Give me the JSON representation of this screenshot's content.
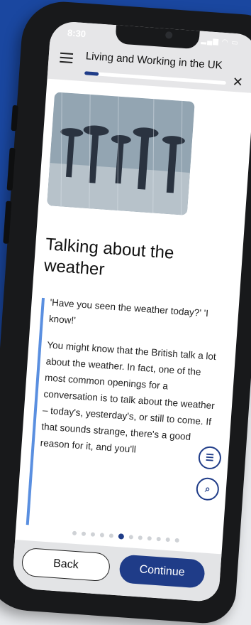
{
  "status_bar": {
    "time": "8:30",
    "icons": "signal wifi battery"
  },
  "header": {
    "title": "Living and Working in the UK",
    "progress": 0.1
  },
  "hero_image": {
    "subject": "people with umbrellas in rain"
  },
  "lesson": {
    "heading": "Talking about the weather",
    "quote": "'Have you seen the weather today?' 'I know!'",
    "paragraph": "You might know that the British talk a lot about the weather. In fact, one of the most common openings for a conversation is to talk about the weather – today's, yesterday's, or still to come. If that sounds strange, there's a good reason for it, and you'll"
  },
  "pagination": {
    "current": 6,
    "total": 14
  },
  "buttons": {
    "back": "Back",
    "continue": "Continue"
  },
  "colors": {
    "brand": "#1f3c88",
    "accent_bar": "#5a8fe0",
    "blue_bg": "#1a47a0"
  }
}
